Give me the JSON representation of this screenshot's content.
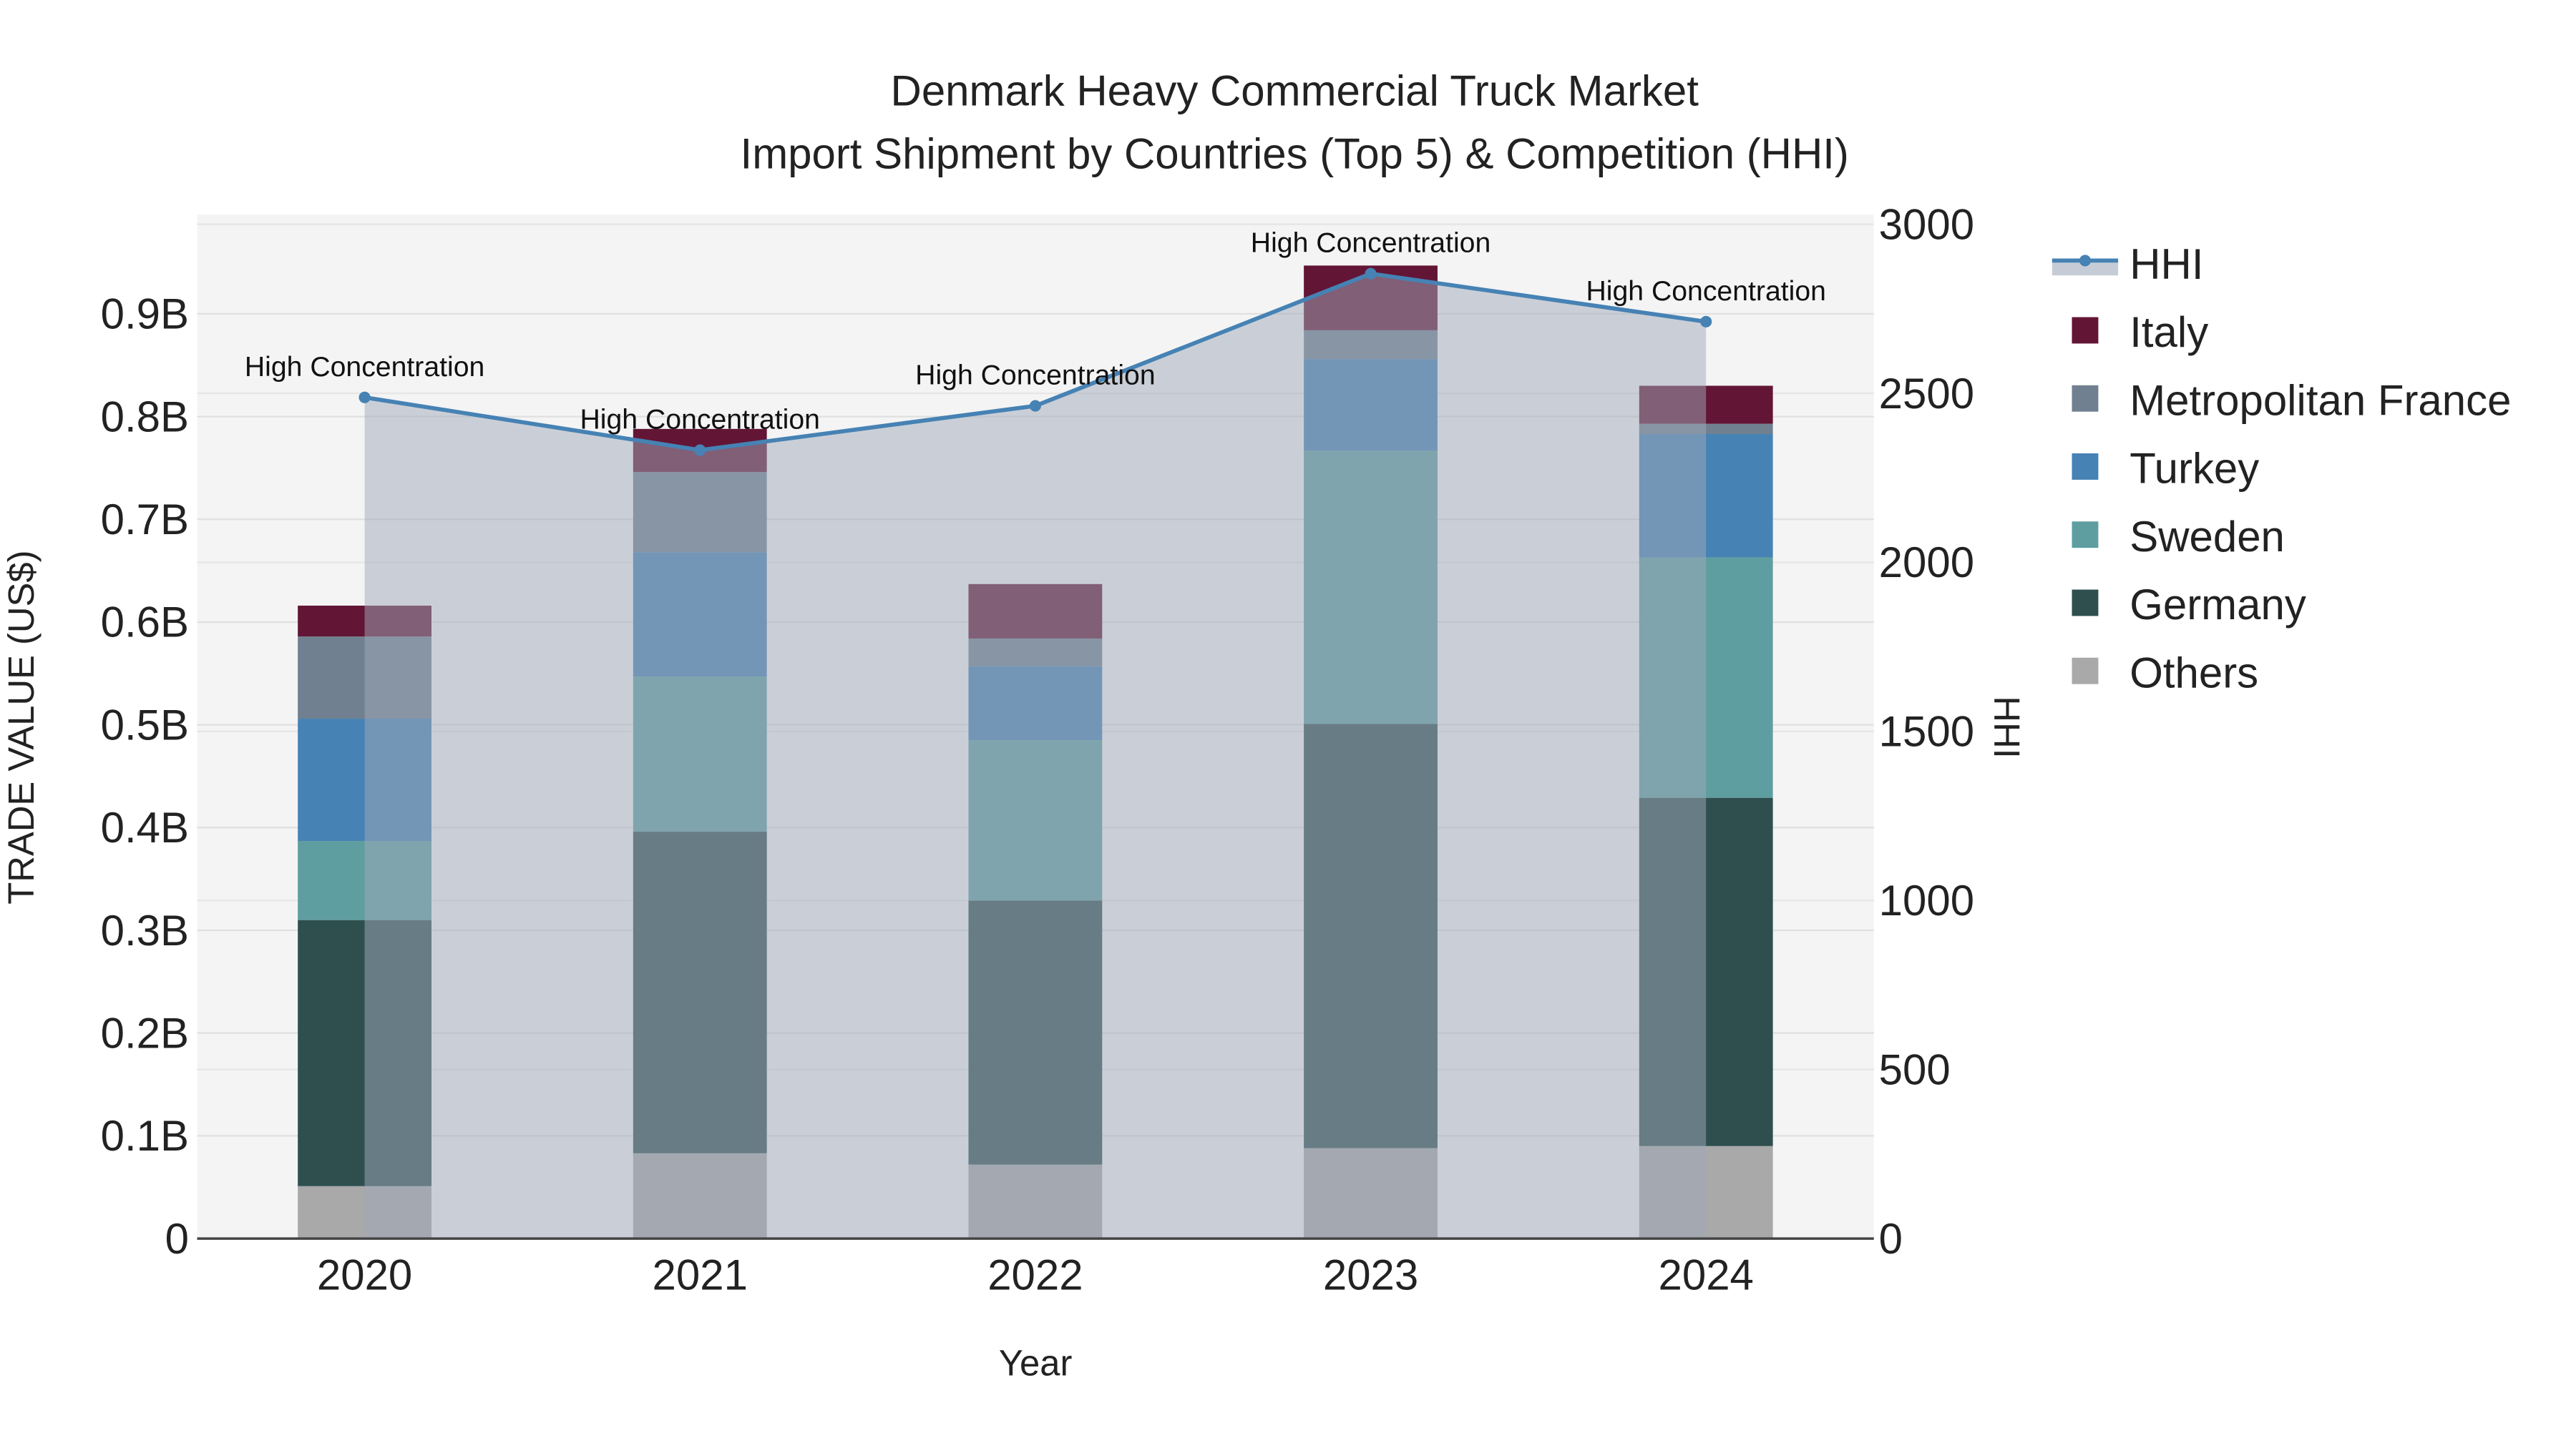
{
  "chart_data": {
    "type": "bar",
    "title_line1": "Denmark Heavy Commercial Truck Market",
    "title_line2": "Import Shipment by Countries (Top 5) & Competition (HHI)",
    "xlabel": "Year",
    "ylabel": "TRADE VALUE (US$)",
    "y2label": "HHI",
    "categories": [
      "2020",
      "2021",
      "2022",
      "2023",
      "2024"
    ],
    "ylim": [
      0,
      0.98
    ],
    "y_ticks": [
      0,
      0.1,
      0.2,
      0.3,
      0.4,
      0.5,
      0.6,
      0.7,
      0.8,
      0.9
    ],
    "y_tick_labels": [
      "0",
      "0.1B",
      "0.2B",
      "0.3B",
      "0.4B",
      "0.5B",
      "0.6B",
      "0.7B",
      "0.8B",
      "0.9B"
    ],
    "y2lim": [
      0,
      3000
    ],
    "y2_ticks": [
      0,
      500,
      1000,
      1500,
      2000,
      2500,
      3000
    ],
    "y2_tick_labels": [
      "0",
      "500",
      "1000",
      "1500",
      "2000",
      "2500",
      "3000"
    ],
    "value_unit": "B US$",
    "series": [
      {
        "name": "Others",
        "color": "#A9A9A9",
        "values": [
          0.051,
          0.083,
          0.072,
          0.088,
          0.09
        ]
      },
      {
        "name": "Germany",
        "color": "#2F4F4F",
        "values": [
          0.259,
          0.313,
          0.257,
          0.413,
          0.339
        ]
      },
      {
        "name": "Sweden",
        "color": "#5F9EA0",
        "values": [
          0.077,
          0.151,
          0.156,
          0.266,
          0.234
        ]
      },
      {
        "name": "Turkey",
        "color": "#4682B4",
        "values": [
          0.119,
          0.121,
          0.072,
          0.089,
          0.12
        ]
      },
      {
        "name": "Metropolitan France",
        "color": "#708090",
        "values": [
          0.08,
          0.078,
          0.027,
          0.028,
          0.01
        ]
      },
      {
        "name": "Italy",
        "color": "#631535",
        "values": [
          0.03,
          0.042,
          0.053,
          0.063,
          0.037
        ]
      }
    ],
    "hhi": {
      "name": "HHI",
      "color": "#4682B4",
      "values": [
        2488,
        2332,
        2463,
        2854,
        2712
      ]
    },
    "annotations": [
      "High Concentration",
      "High Concentration",
      "High Concentration",
      "High Concentration",
      "High Concentration"
    ],
    "legend_order": [
      "HHI",
      "Italy",
      "Metropolitan France",
      "Turkey",
      "Sweden",
      "Germany",
      "Others"
    ],
    "legend_position": "right",
    "grid": true
  }
}
